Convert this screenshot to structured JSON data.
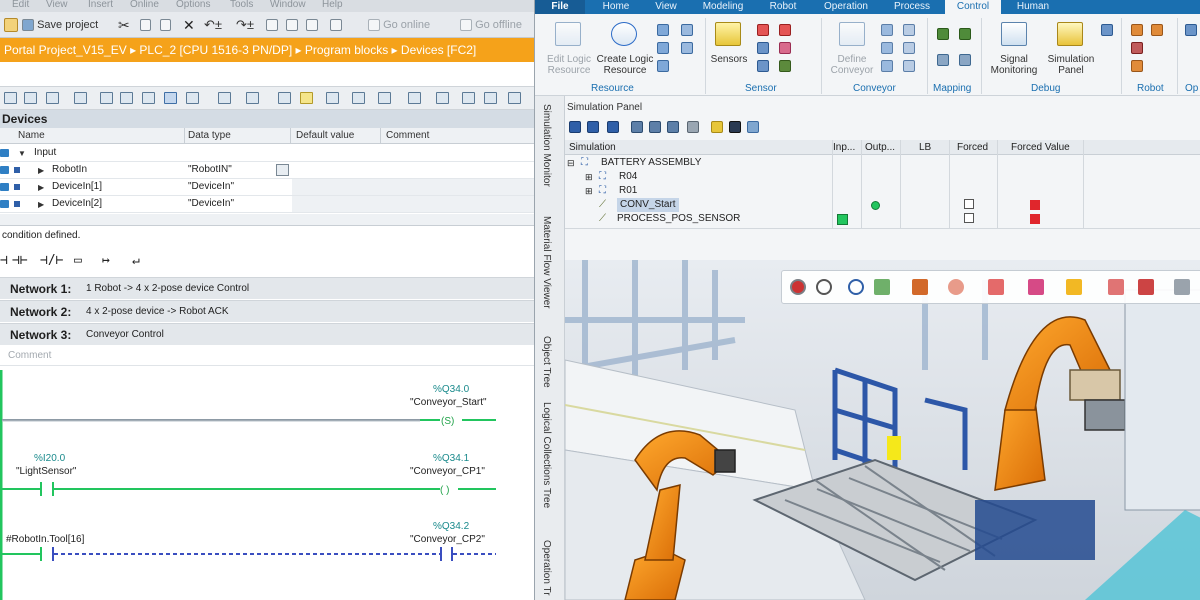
{
  "tia": {
    "menu": [
      "Edit",
      "View",
      "Insert",
      "Online",
      "Options",
      "Tools",
      "Window",
      "Help"
    ],
    "toolbar": {
      "save_project": "Save project",
      "go_online": "Go online",
      "go_offline": "Go offline"
    },
    "breadcrumb": "Portal Project_V15_EV  ▸  PLC_2 [CPU 1516-3 PN/DP]  ▸  Program blocks  ▸  Devices [FC2]",
    "interface": {
      "title": "Devices",
      "columns": [
        "Name",
        "Data type",
        "Default value",
        "Comment"
      ],
      "section": "Input",
      "rows": [
        {
          "name": "RobotIn",
          "type": "\"RobotIN\""
        },
        {
          "name": "DeviceIn[1]",
          "type": "\"DeviceIn\""
        },
        {
          "name": "DeviceIn[2]",
          "type": "\"DeviceIn\""
        }
      ]
    },
    "condition": "condition defined.",
    "networks": [
      {
        "label": "Network 1:",
        "title": "1 Robot -> 4 x 2-pose device Control"
      },
      {
        "label": "Network 2:",
        "title": "4 x 2-pose device -> Robot ACK"
      },
      {
        "label": "Network 3:",
        "title": "Conveyor Control"
      }
    ],
    "comment_placeholder": "Comment",
    "rungs": {
      "r1": {
        "out_addr": "%Q34.0",
        "out_tag": "\"Conveyor_Start\""
      },
      "r2": {
        "in_addr": "%I20.0",
        "in_tag": "\"LightSensor\"",
        "out_addr": "%Q34.1",
        "out_tag": "\"Conveyor_CP1\""
      },
      "r3": {
        "in_tag": "#RobotIn.Tool[16]",
        "out_addr": "%Q34.2",
        "out_tag": "\"Conveyor_CP2\""
      }
    }
  },
  "ps": {
    "tabs": [
      "File",
      "Home",
      "View",
      "Modeling",
      "Robot",
      "Operation",
      "Process",
      "Control",
      "Human"
    ],
    "active_tab": "Control",
    "ribbon": {
      "edit_logic": "Edit Logic Resource",
      "create_logic": "Create Logic Resource",
      "sensors": "Sensors",
      "define_conveyor": "Define Conveyor",
      "signal_monitoring": "Signal Monitoring",
      "simulation_panel": "Simulation Panel",
      "groups": [
        "Resource",
        "Sensor",
        "Conveyor",
        "Mapping",
        "Debug",
        "Robot",
        "Op"
      ]
    },
    "side_tabs": [
      "Simulation Monitor",
      "Material Flow Viewer",
      "Object Tree",
      "Logical Collections Tree",
      "Operation Tr"
    ],
    "sim_panel": {
      "title": "Simulation Panel",
      "columns": [
        "Simulation",
        "Inp...",
        "Outp...",
        "LB",
        "Forced",
        "Forced Value"
      ],
      "rows": [
        {
          "label": "BATTERY ASSEMBLY"
        },
        {
          "label": "R04"
        },
        {
          "label": "R01"
        },
        {
          "label": "CONV_Start"
        },
        {
          "label": "PROCESS_POS_SENSOR"
        }
      ]
    },
    "colors": {
      "accent": "#1a6fb0",
      "orange": "#f5a21a",
      "robot": "#f08a12",
      "green": "#22c55e",
      "red": "#e0262c"
    }
  }
}
